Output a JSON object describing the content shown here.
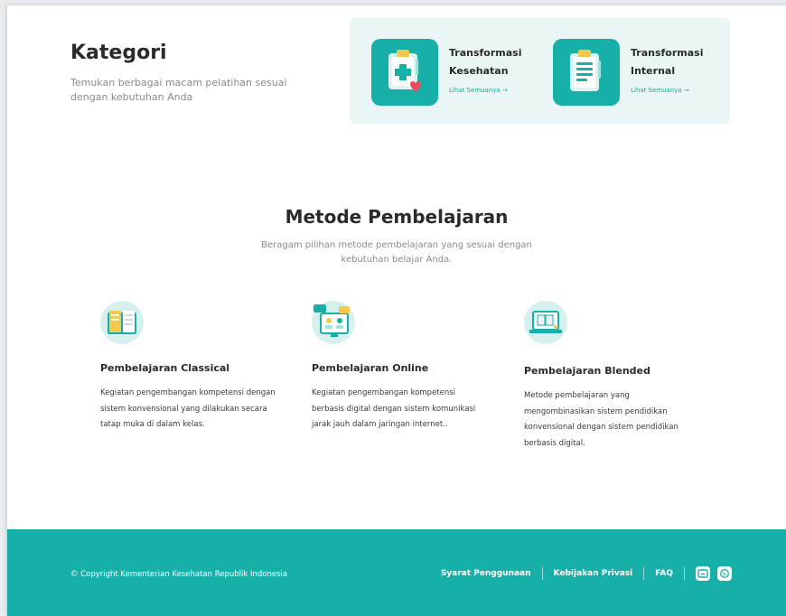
{
  "kategori": {
    "title": "Kategori",
    "description": "Temukan berbagai macam pelatihan sesuai dengan kebutuhan Anda",
    "cards": [
      {
        "name": "Transformasi Kesehatan",
        "link": "Lihat Semuanya →",
        "icon": "health-clipboard-icon"
      },
      {
        "name": "Transformasi Internal",
        "link": "Lihat Semuanya →",
        "icon": "document-clipboard-icon"
      }
    ]
  },
  "metode": {
    "title": "Metode Pembelajaran",
    "subtitle": "Beragam pilihan metode pembelajaran yang sesuai dengan kebutuhan belajar Anda.",
    "items": [
      {
        "name": "Pembelajaran Classical",
        "description": "Kegiatan pengembangan kompetensi dengan sistem konvensional yang dilakukan secara tatap muka di dalam kelas.",
        "icon": "open-book-icon"
      },
      {
        "name": "Pembelajaran Online",
        "description": "Kegiatan pengembangan kompetensi berbasis digital dengan sistem komunikasi jarak jauh dalam jaringan internet..",
        "icon": "online-meeting-icon"
      },
      {
        "name": "Pembelajaran Blended",
        "description": "Metode pembelajaran yang mengombinasikan sistem pendidikan konvensional dengan sistem pendidikan berbasis digital.",
        "icon": "laptop-book-icon"
      }
    ]
  },
  "footer": {
    "copyright": "© Copyright Kementerian Kesehatan Republik Indonesia",
    "links": [
      "Syarat Penggunaan",
      "Kebijakan Privasi",
      "FAQ"
    ],
    "icons": [
      "mail-icon",
      "whatsapp-icon"
    ]
  },
  "colors": {
    "accent": "#17b0a8",
    "panel_bg": "#e9f6f5",
    "icon_circle": "#d6f0ee"
  }
}
